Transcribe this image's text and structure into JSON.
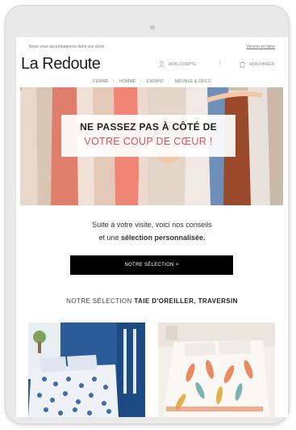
{
  "header": {
    "tagline": "Nous vous accompagnons dans vos choix",
    "web_version": "Version en ligne",
    "logo": "La Redoute",
    "account_label": "MON COMPTE",
    "cart_label": "MON PANIER"
  },
  "nav": {
    "items": [
      {
        "label": "FEMME"
      },
      {
        "label": "HOMME"
      },
      {
        "label": "ENFANT"
      },
      {
        "label": "MEUBLE & DÉCO"
      }
    ]
  },
  "hero": {
    "line1": "NE PASSEZ PAS À CÔTÉ DE",
    "line2": "VOTRE COUP DE CŒUR !"
  },
  "body": {
    "line1": "Suite à votre visite, voici nos conseils",
    "line2_prefix": "et une",
    "line2_bold": "sélection personnalisée."
  },
  "cta": {
    "label": "NOTRE SÉLECTION >"
  },
  "selection": {
    "prefix": "NOTRE SÉLECTION",
    "bold": "TAIE D'OREILLER, TRAVERSIN"
  },
  "colors": {
    "accent_red": "#e24d57",
    "cta_bg": "#000000",
    "nav_text": "#777777"
  },
  "icons": [
    "account-icon",
    "cart-icon"
  ]
}
